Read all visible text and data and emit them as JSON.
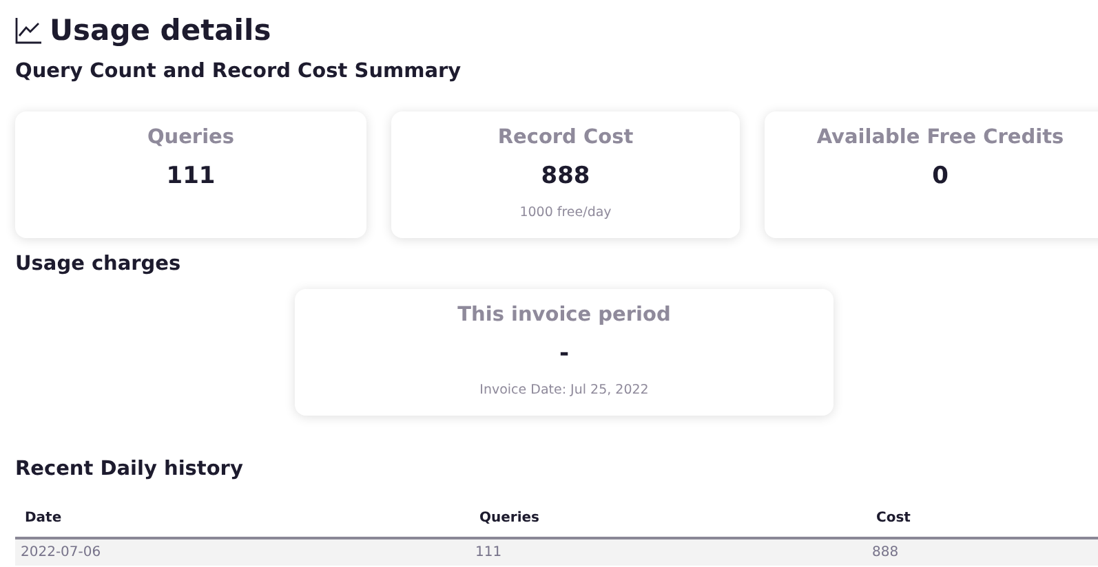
{
  "title": "Usage details",
  "summary": {
    "heading": "Query Count and Record Cost Summary",
    "cards": [
      {
        "label": "Queries",
        "value": "111"
      },
      {
        "label": "Record Cost",
        "value": "888",
        "note": "1000 free/day"
      },
      {
        "label": "Available Free Credits",
        "value": "0"
      }
    ]
  },
  "charges": {
    "heading": "Usage charges",
    "card": {
      "label": "This invoice period",
      "value": "-",
      "note": "Invoice Date: Jul 25, 2022"
    }
  },
  "history": {
    "heading": "Recent Daily history",
    "columns": [
      "Date",
      "Queries",
      "Cost"
    ],
    "rows": [
      [
        "2022-07-06",
        "111",
        "888"
      ]
    ]
  }
}
